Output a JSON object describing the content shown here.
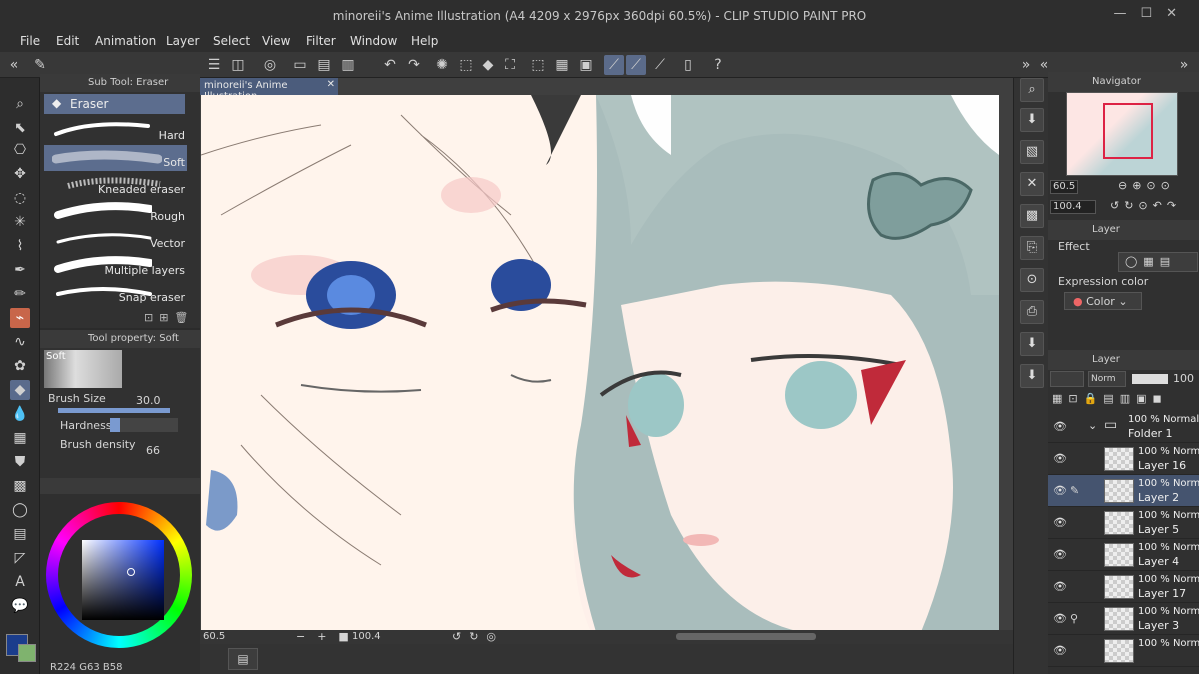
{
  "window": {
    "title": "minoreii's Anime Illustration (A4 4209 x 2976px 360dpi 60.5%) - CLIP STUDIO PAINT PRO"
  },
  "menu": [
    "File",
    "Edit",
    "Animation",
    "Layer",
    "Select",
    "View",
    "Filter",
    "Window",
    "Help"
  ],
  "subtool_panel": {
    "title": "Sub Tool: Eraser",
    "group": "Eraser",
    "brushes": [
      "Hard",
      "Soft",
      "Kneaded eraser",
      "Rough",
      "Vector",
      "Multiple layers",
      "Snap eraser"
    ],
    "selected": "Soft"
  },
  "tool_property": {
    "title": "Tool property: Soft",
    "preset": "Soft",
    "brush_size_label": "Brush Size",
    "brush_size": "30.0",
    "hardness_label": "Hardness",
    "density_label": "Brush density",
    "density": "66"
  },
  "color": {
    "current": "#1b3d8c",
    "r": "224",
    "g": "63",
    "b": "58"
  },
  "canvas": {
    "tab": "minoreii's Anime Illustration",
    "zoom": "60.5",
    "angle": "100.4"
  },
  "navigator": {
    "title": "Navigator",
    "zoom": "60.5",
    "rotation": "100.4"
  },
  "layer_property": {
    "title": "Layer",
    "effect_label": "Effect",
    "expression_label": "Expression color",
    "expression_value": "Color"
  },
  "layer_panel": {
    "title": "Layer",
    "blend": "Norm",
    "opacity": "100",
    "layers": [
      {
        "blend": "100 % Normal",
        "name": "Folder 1",
        "folder": true
      },
      {
        "blend": "100 % Norm",
        "name": "Layer 16"
      },
      {
        "blend": "100 % Norm",
        "name": "Layer 2",
        "selected": true
      },
      {
        "blend": "100 % Norm",
        "name": "Layer 5"
      },
      {
        "blend": "100 % Norm",
        "name": "Layer 4"
      },
      {
        "blend": "100 % Norm",
        "name": "Layer 17"
      },
      {
        "blend": "100 % Norm",
        "name": "Layer 3"
      },
      {
        "blend": "100 % Norm",
        "name": ""
      }
    ]
  }
}
